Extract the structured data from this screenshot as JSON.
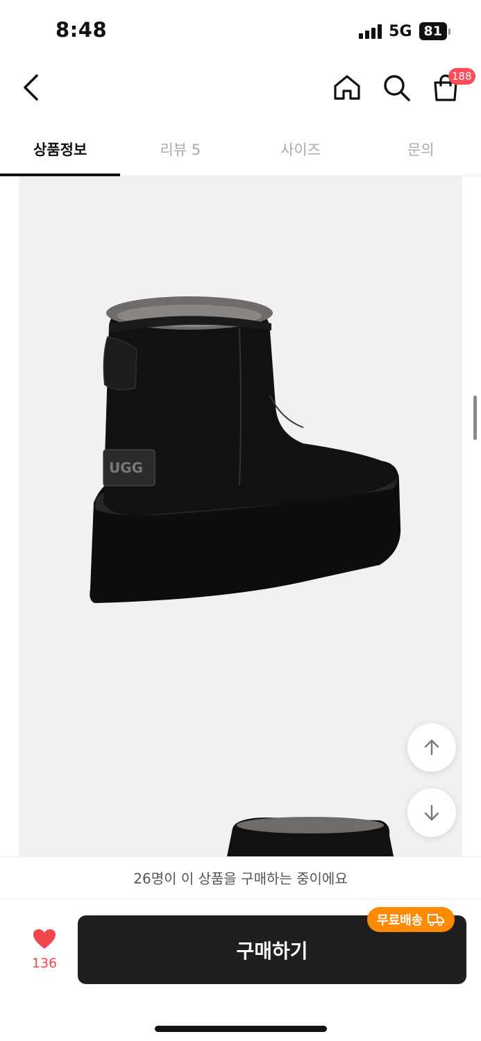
{
  "status_bar": {
    "time": "8:48",
    "network": "5G",
    "battery": "81"
  },
  "nav": {
    "icons": [
      "chevron-left-icon",
      "home-icon",
      "search-icon",
      "shopping-bag-icon"
    ],
    "cart_count": "188"
  },
  "tabs": [
    {
      "label": "상품정보",
      "active": true
    },
    {
      "label": "리뷰 5",
      "active": false
    },
    {
      "label": "사이즈",
      "active": false
    },
    {
      "label": "문의",
      "active": false
    }
  ],
  "product_image": {
    "brand_tag": "UGG"
  },
  "buyers_notice": "26명이 이 상품을 구매하는 중이에요",
  "bottom": {
    "like_count": "136",
    "buy_label": "구매하기",
    "shipping_badge": "무료배송"
  },
  "colors": {
    "accent_red": "#f0474f",
    "badge_orange": "#ff8a00",
    "buy_button": "#1f1f1f"
  }
}
